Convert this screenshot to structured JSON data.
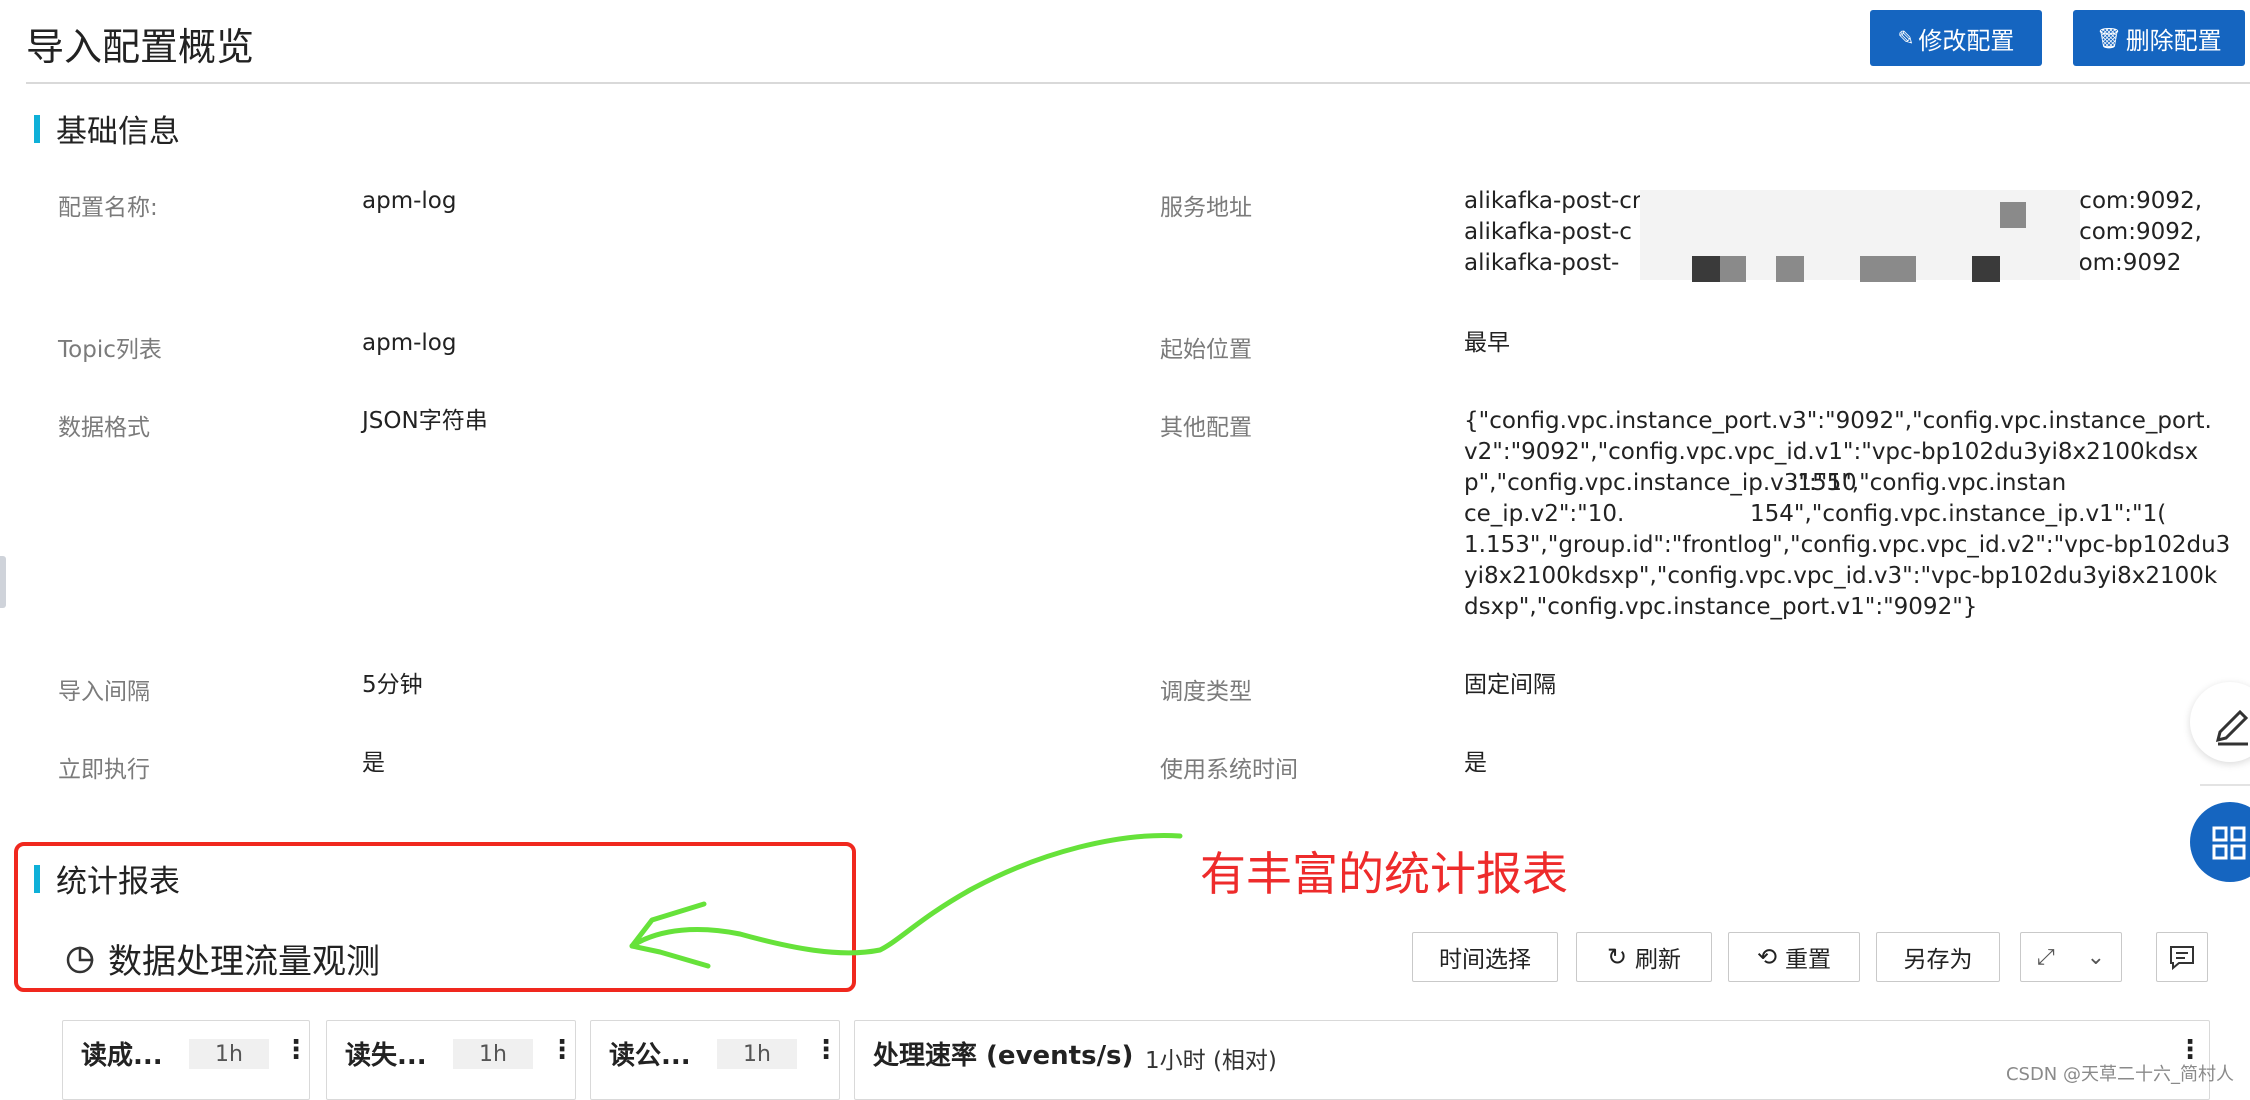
{
  "header": {
    "title": "导入配置概览",
    "edit_label": "修改配置",
    "delete_label": "删除配置"
  },
  "basic": {
    "section_title": "基础信息",
    "fields": {
      "config_name": {
        "label": "配置名称:",
        "value": "apm-log"
      },
      "service_addr": {
        "label": "服务地址",
        "lines": [
          "alikafka-post-cn-",
          "s.com:9092,",
          "alikafka-post-c",
          "uncs.com:9092,",
          "alikafka-post-",
          "cs.com:9092"
        ]
      },
      "topic_list": {
        "label": "Topic列表",
        "value": "apm-log"
      },
      "start_pos": {
        "label": "起始位置",
        "value": "最早"
      },
      "data_format": {
        "label": "数据格式",
        "value": "JSON字符串"
      },
      "other_config": {
        "label": "其他配置",
        "lines": [
          "{\"config.vpc.instance_port.v3\":\"9092\",\"config.vpc.instance_port.",
          "v2\":\"9092\",\"config.vpc.vpc_id.v1\":\"vpc-bp102du3yi8x2100kdsx",
          "p\",\"config.vpc.instance_ip.v3\":\"10",
          ".155\",\"config.vpc.instan",
          "ce_ip.v2\":\"10.",
          "154\",\"config.vpc.instance_ip.v1\":\"1(",
          "1.153\",\"group.id\":\"frontlog\",\"config.vpc.vpc_id.v2\":\"vpc-bp102du3",
          "yi8x2100kdsxp\",\"config.vpc.vpc_id.v3\":\"vpc-bp102du3yi8x2100k",
          "dsxp\",\"config.vpc.instance_port.v1\":\"9092\"}"
        ]
      },
      "import_interval": {
        "label": "导入间隔",
        "value": "5分钟"
      },
      "schedule_type": {
        "label": "调度类型",
        "value": "固定间隔"
      },
      "run_now": {
        "label": "立即执行",
        "value": "是"
      },
      "use_sys_time": {
        "label": "使用系统时间",
        "value": "是"
      }
    }
  },
  "stats": {
    "section_title": "统计报表",
    "dashboard_title": "数据处理流量观测",
    "toolbar": {
      "time_select": "时间选择",
      "refresh": "刷新",
      "reset": "重置",
      "save_as": "另存为"
    },
    "cards": [
      {
        "title": "读成...",
        "chip": "1h"
      },
      {
        "title": "读失...",
        "chip": "1h"
      },
      {
        "title": "读公...",
        "chip": "1h"
      }
    ],
    "rate_card": {
      "title": "处理速率 (events/s)",
      "range": "1小时 (相对)"
    }
  },
  "annotation": {
    "text": "有丰富的统计报表",
    "color": "#ee2b2b"
  },
  "watermark": "CSDN @天草二十六_简村人",
  "colors": {
    "primary": "#1565c0",
    "accent_bar": "#0fb0d8",
    "annotation_red": "#f0281e",
    "arrow_green": "#66e23a"
  }
}
